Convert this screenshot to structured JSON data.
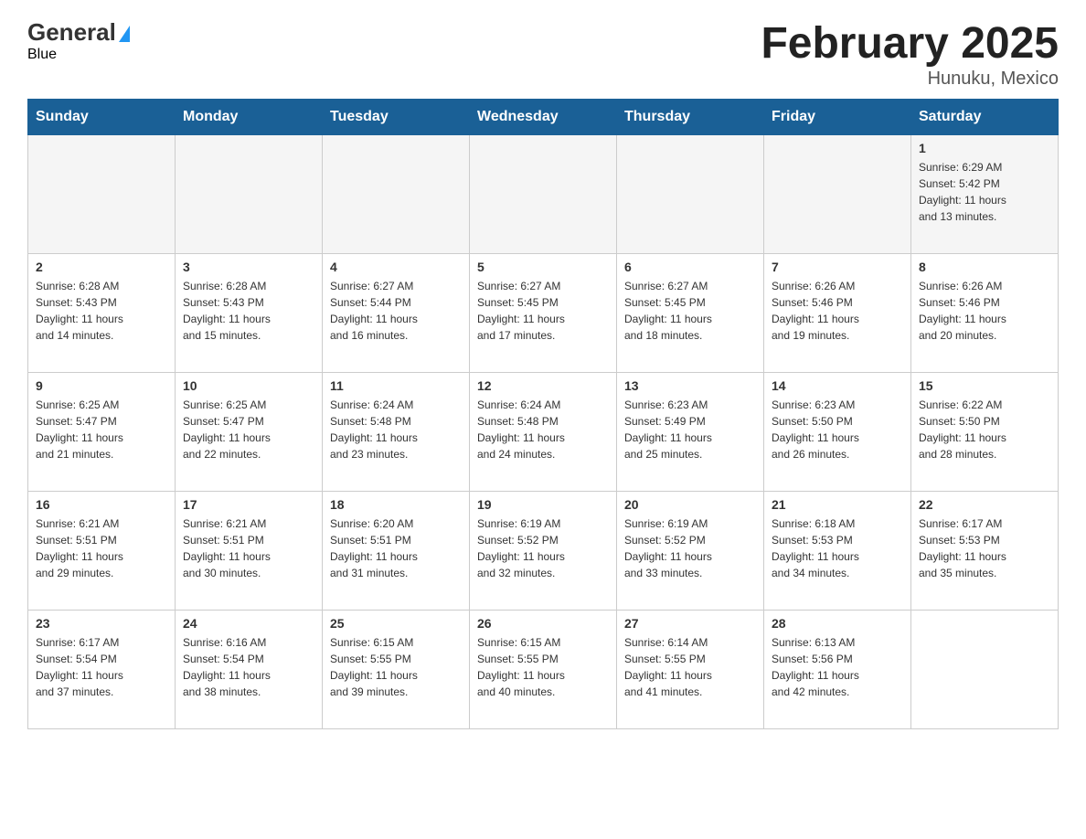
{
  "header": {
    "logo_general": "General",
    "logo_blue": "Blue",
    "title": "February 2025",
    "subtitle": "Hunuku, Mexico"
  },
  "days_of_week": [
    "Sunday",
    "Monday",
    "Tuesday",
    "Wednesday",
    "Thursday",
    "Friday",
    "Saturday"
  ],
  "weeks": [
    [
      {
        "day": "",
        "info": ""
      },
      {
        "day": "",
        "info": ""
      },
      {
        "day": "",
        "info": ""
      },
      {
        "day": "",
        "info": ""
      },
      {
        "day": "",
        "info": ""
      },
      {
        "day": "",
        "info": ""
      },
      {
        "day": "1",
        "info": "Sunrise: 6:29 AM\nSunset: 5:42 PM\nDaylight: 11 hours\nand 13 minutes."
      }
    ],
    [
      {
        "day": "2",
        "info": "Sunrise: 6:28 AM\nSunset: 5:43 PM\nDaylight: 11 hours\nand 14 minutes."
      },
      {
        "day": "3",
        "info": "Sunrise: 6:28 AM\nSunset: 5:43 PM\nDaylight: 11 hours\nand 15 minutes."
      },
      {
        "day": "4",
        "info": "Sunrise: 6:27 AM\nSunset: 5:44 PM\nDaylight: 11 hours\nand 16 minutes."
      },
      {
        "day": "5",
        "info": "Sunrise: 6:27 AM\nSunset: 5:45 PM\nDaylight: 11 hours\nand 17 minutes."
      },
      {
        "day": "6",
        "info": "Sunrise: 6:27 AM\nSunset: 5:45 PM\nDaylight: 11 hours\nand 18 minutes."
      },
      {
        "day": "7",
        "info": "Sunrise: 6:26 AM\nSunset: 5:46 PM\nDaylight: 11 hours\nand 19 minutes."
      },
      {
        "day": "8",
        "info": "Sunrise: 6:26 AM\nSunset: 5:46 PM\nDaylight: 11 hours\nand 20 minutes."
      }
    ],
    [
      {
        "day": "9",
        "info": "Sunrise: 6:25 AM\nSunset: 5:47 PM\nDaylight: 11 hours\nand 21 minutes."
      },
      {
        "day": "10",
        "info": "Sunrise: 6:25 AM\nSunset: 5:47 PM\nDaylight: 11 hours\nand 22 minutes."
      },
      {
        "day": "11",
        "info": "Sunrise: 6:24 AM\nSunset: 5:48 PM\nDaylight: 11 hours\nand 23 minutes."
      },
      {
        "day": "12",
        "info": "Sunrise: 6:24 AM\nSunset: 5:48 PM\nDaylight: 11 hours\nand 24 minutes."
      },
      {
        "day": "13",
        "info": "Sunrise: 6:23 AM\nSunset: 5:49 PM\nDaylight: 11 hours\nand 25 minutes."
      },
      {
        "day": "14",
        "info": "Sunrise: 6:23 AM\nSunset: 5:50 PM\nDaylight: 11 hours\nand 26 minutes."
      },
      {
        "day": "15",
        "info": "Sunrise: 6:22 AM\nSunset: 5:50 PM\nDaylight: 11 hours\nand 28 minutes."
      }
    ],
    [
      {
        "day": "16",
        "info": "Sunrise: 6:21 AM\nSunset: 5:51 PM\nDaylight: 11 hours\nand 29 minutes."
      },
      {
        "day": "17",
        "info": "Sunrise: 6:21 AM\nSunset: 5:51 PM\nDaylight: 11 hours\nand 30 minutes."
      },
      {
        "day": "18",
        "info": "Sunrise: 6:20 AM\nSunset: 5:51 PM\nDaylight: 11 hours\nand 31 minutes."
      },
      {
        "day": "19",
        "info": "Sunrise: 6:19 AM\nSunset: 5:52 PM\nDaylight: 11 hours\nand 32 minutes."
      },
      {
        "day": "20",
        "info": "Sunrise: 6:19 AM\nSunset: 5:52 PM\nDaylight: 11 hours\nand 33 minutes."
      },
      {
        "day": "21",
        "info": "Sunrise: 6:18 AM\nSunset: 5:53 PM\nDaylight: 11 hours\nand 34 minutes."
      },
      {
        "day": "22",
        "info": "Sunrise: 6:17 AM\nSunset: 5:53 PM\nDaylight: 11 hours\nand 35 minutes."
      }
    ],
    [
      {
        "day": "23",
        "info": "Sunrise: 6:17 AM\nSunset: 5:54 PM\nDaylight: 11 hours\nand 37 minutes."
      },
      {
        "day": "24",
        "info": "Sunrise: 6:16 AM\nSunset: 5:54 PM\nDaylight: 11 hours\nand 38 minutes."
      },
      {
        "day": "25",
        "info": "Sunrise: 6:15 AM\nSunset: 5:55 PM\nDaylight: 11 hours\nand 39 minutes."
      },
      {
        "day": "26",
        "info": "Sunrise: 6:15 AM\nSunset: 5:55 PM\nDaylight: 11 hours\nand 40 minutes."
      },
      {
        "day": "27",
        "info": "Sunrise: 6:14 AM\nSunset: 5:55 PM\nDaylight: 11 hours\nand 41 minutes."
      },
      {
        "day": "28",
        "info": "Sunrise: 6:13 AM\nSunset: 5:56 PM\nDaylight: 11 hours\nand 42 minutes."
      },
      {
        "day": "",
        "info": ""
      }
    ]
  ]
}
